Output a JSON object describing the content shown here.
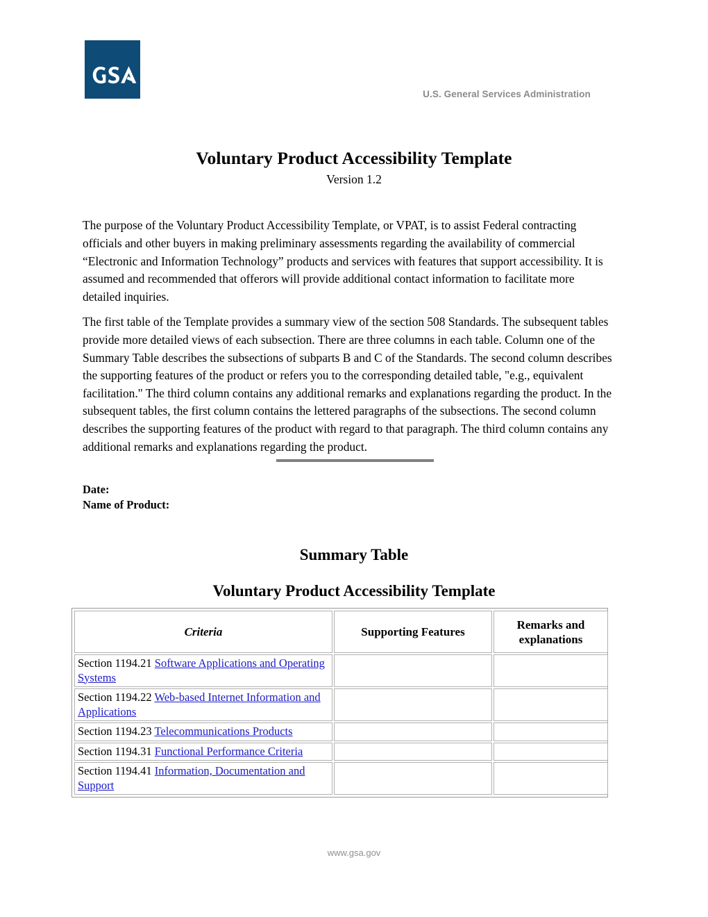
{
  "header": {
    "logo_text": "GSA",
    "logo_bg_color": "#0e4b76",
    "agency_name": "U.S. General Services Administration"
  },
  "document": {
    "title": "Voluntary Product Accessibility Template",
    "version": "Version 1.2",
    "paragraphs": [
      "The purpose of the Voluntary Product Accessibility Template, or VPAT, is to assist Federal contracting officials and other buyers in making preliminary assessments regarding the availability of commercial “Electronic and Information Technology” products and services with features that support accessibility. It is assumed and recommended that offerors will provide additional contact information to facilitate more detailed inquiries.",
      "The first table of the Template provides a summary view of the section 508 Standards. The subsequent tables provide more detailed views of each subsection. There are three columns in each table. Column one of the Summary Table describes the subsections of subparts B and C of the Standards. The second column describes the supporting features of the product or refers you to the corresponding detailed table, \"e.g., equivalent facilitation.\" The third column contains any additional remarks and explanations regarding the product. In the subsequent tables, the first column contains the lettered paragraphs of the subsections. The second column describes the supporting features of the product with regard to that paragraph. The third column contains any additional remarks and explanations regarding the product."
    ]
  },
  "fields": {
    "date_label": "Date:",
    "product_label": "Name of Product:"
  },
  "summary": {
    "heading_1": "Summary Table",
    "heading_2": "Voluntary Product Accessibility Template",
    "columns": [
      "Criteria",
      "Supporting Features",
      "Remarks and explanations"
    ],
    "rows": [
      {
        "section": "Section 1194.21 ",
        "link": "Software Applications and Operating Systems",
        "supporting_features": "",
        "remarks": ""
      },
      {
        "section": "Section 1194.22 ",
        "link": "Web-based Internet Information and Applications",
        "supporting_features": "",
        "remarks": ""
      },
      {
        "section": "Section 1194.23 ",
        "link": "Telecommunications Products",
        "supporting_features": "",
        "remarks": ""
      },
      {
        "section": "Section 1194.31 ",
        "link": "Functional Performance Criteria",
        "supporting_features": "",
        "remarks": ""
      },
      {
        "section": "Section 1194.41 ",
        "link": "Information, Documentation and Support",
        "supporting_features": "",
        "remarks": ""
      }
    ],
    "link_color": "#1b1bc7",
    "border_color": "#b0b0b0"
  },
  "footer": {
    "url": "www.gsa.gov"
  }
}
